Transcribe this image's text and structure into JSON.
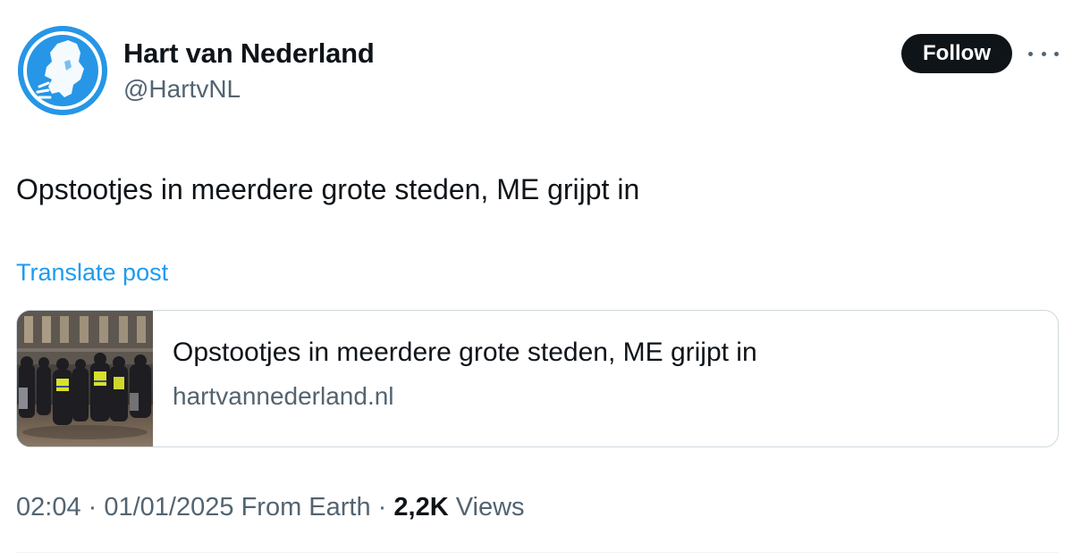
{
  "account": {
    "name": "Hart van Nederland",
    "handle": "@HartvNL",
    "avatar_icon": "netherlands-map-logo",
    "avatar_color": "#2796e6"
  },
  "actions": {
    "follow_label": "Follow",
    "more_icon": "more-horizontal-icon"
  },
  "post": {
    "text": "Opstootjes in meerdere grote steden, ME grijpt in",
    "translate_label": "Translate post"
  },
  "link_card": {
    "title": "Opstootjes in meerdere grote steden, ME grijpt in",
    "domain": "hartvannederland.nl",
    "thumbnail": "police-crowd-photo"
  },
  "meta": {
    "time": "02:04",
    "sep1": " · ",
    "date": "01/01/2025",
    "source": " From Earth",
    "sep2": " · ",
    "views_count": "2,2K",
    "views_label": " Views"
  },
  "colors": {
    "accent": "#1d9bf0",
    "text": "#0f1419",
    "muted": "#536471",
    "button_bg": "#0f1419"
  }
}
